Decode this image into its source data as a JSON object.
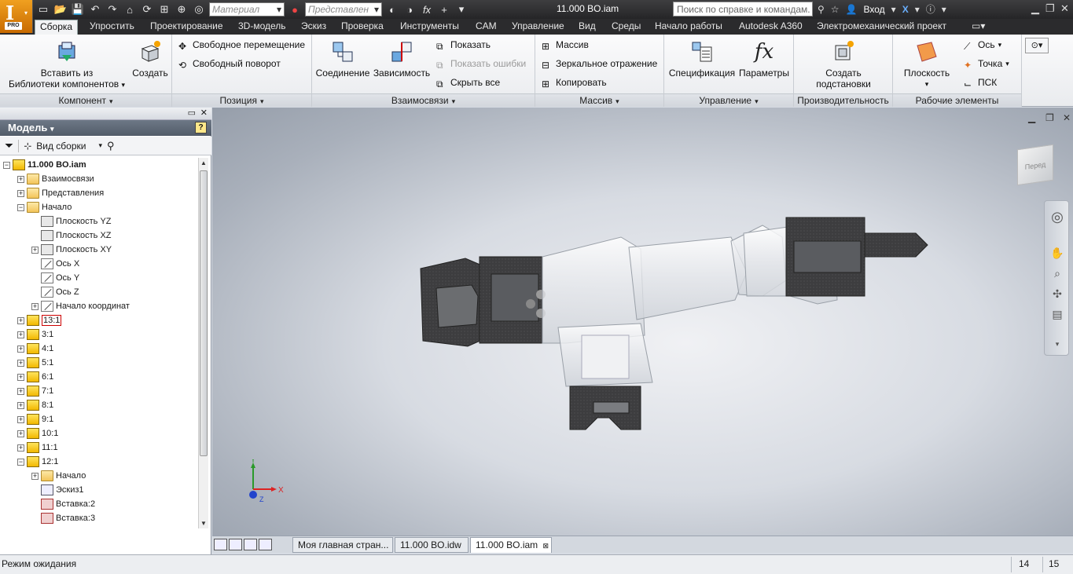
{
  "title_bar": {
    "document_title": "11.000 BO.iam",
    "material_placeholder": "Материал",
    "appearance_placeholder": "Представлен",
    "help_search": "Поиск по справке и командам.",
    "login": "Вход",
    "app_badge": "PRO"
  },
  "ribbon_tabs": [
    "Сборка",
    "Упростить",
    "Проектирование",
    "3D-модель",
    "Эскиз",
    "Проверка",
    "Инструменты",
    "CAM",
    "Управление",
    "Вид",
    "Среды",
    "Начало работы",
    "Autodesk A360",
    "Электромеханический проект"
  ],
  "ribbon": {
    "component": {
      "title": "Компонент",
      "insert_label_1": "Вставить из",
      "insert_label_2": "Библиотеки компонентов",
      "create_label": "Создать"
    },
    "position": {
      "title": "Позиция",
      "free_move": "Свободное перемещение",
      "free_rotate": "Свободный поворот"
    },
    "relationships": {
      "title": "Взаимосвязи",
      "joint": "Соединение",
      "constraint": "Зависимость",
      "show": "Показать",
      "show_errors": "Показать ошибки",
      "hide_all": "Скрыть все"
    },
    "pattern": {
      "title": "Массив",
      "pattern": "Массив",
      "mirror": "Зеркальное отражение",
      "copy": "Копировать"
    },
    "manage": {
      "title": "Управление",
      "bom": "Спецификация",
      "parameters": "Параметры"
    },
    "productivity": {
      "title": "Производительность",
      "substitute_1": "Создать",
      "substitute_2": "подстановки"
    },
    "work_features": {
      "title": "Рабочие элементы",
      "plane": "Плоскость",
      "axis": "Ось",
      "point": "Точка",
      "ucs": "ПСК"
    }
  },
  "browser": {
    "header": "Модель",
    "view_label": "Вид сборки",
    "tree": [
      {
        "label": "11.000 BO.iam",
        "level": 0,
        "icon": "assembly-icon",
        "expander": "minus"
      },
      {
        "label": "Взаимосвязи",
        "level": 1,
        "icon": "folder-icon",
        "expander": "plus"
      },
      {
        "label": "Представления",
        "level": 1,
        "icon": "representations-icon",
        "expander": "plus"
      },
      {
        "label": "Начало",
        "level": 1,
        "icon": "folder-open-icon",
        "expander": "minus"
      },
      {
        "label": "Плоскость YZ",
        "level": 2,
        "icon": "plane-icon",
        "expander": "none"
      },
      {
        "label": "Плоскость XZ",
        "level": 2,
        "icon": "plane-icon",
        "expander": "none"
      },
      {
        "label": "Плоскость XY",
        "level": 2,
        "icon": "plane-icon",
        "expander": "plus"
      },
      {
        "label": "Ось X",
        "level": 2,
        "icon": "axis-icon",
        "expander": "none"
      },
      {
        "label": "Ось Y",
        "level": 2,
        "icon": "axis-icon",
        "expander": "none"
      },
      {
        "label": "Ось Z",
        "level": 2,
        "icon": "axis-icon",
        "expander": "none"
      },
      {
        "label": "Начало координат",
        "level": 2,
        "icon": "origin-point-icon",
        "expander": "plus"
      },
      {
        "label": "13:1",
        "level": 1,
        "icon": "component-edited-icon",
        "expander": "plus"
      },
      {
        "label": "3:1",
        "level": 1,
        "icon": "component-icon",
        "expander": "plus"
      },
      {
        "label": "4:1",
        "level": 1,
        "icon": "component-icon",
        "expander": "plus"
      },
      {
        "label": "5:1",
        "level": 1,
        "icon": "component-icon",
        "expander": "plus"
      },
      {
        "label": "6:1",
        "level": 1,
        "icon": "component-icon",
        "expander": "plus"
      },
      {
        "label": "7:1",
        "level": 1,
        "icon": "component-icon",
        "expander": "plus"
      },
      {
        "label": "8:1",
        "level": 1,
        "icon": "component-icon",
        "expander": "plus"
      },
      {
        "label": "9:1",
        "level": 1,
        "icon": "component-icon",
        "expander": "plus"
      },
      {
        "label": "10:1",
        "level": 1,
        "icon": "component-icon",
        "expander": "plus"
      },
      {
        "label": "11:1",
        "level": 1,
        "icon": "component-icon",
        "expander": "plus"
      },
      {
        "label": "12:1",
        "level": 1,
        "icon": "component-icon",
        "expander": "minus"
      },
      {
        "label": "Начало",
        "level": 2,
        "icon": "folder-icon",
        "expander": "plus"
      },
      {
        "label": "Эскиз1",
        "level": 2,
        "icon": "sketch-icon",
        "expander": "none"
      },
      {
        "label": "Вставка:2",
        "level": 2,
        "icon": "insert-icon",
        "expander": "none"
      },
      {
        "label": "Вставка:3",
        "level": 2,
        "icon": "insert-icon",
        "expander": "none"
      }
    ]
  },
  "viewport": {
    "viewcube_face": "Перед",
    "triad_x": "X",
    "triad_y": "Y",
    "triad_z": "Z"
  },
  "doc_tabs": [
    "Моя главная стран...",
    "11.000 BO.idw",
    "11.000 BO.iam"
  ],
  "status_bar": {
    "message": "Режим ожидания",
    "count_1": "14",
    "count_2": "15"
  },
  "colors": {
    "accent_orange": "#e89418",
    "dark_chrome": "#2b2b2d",
    "viewport_bg": "#c5cad3"
  }
}
